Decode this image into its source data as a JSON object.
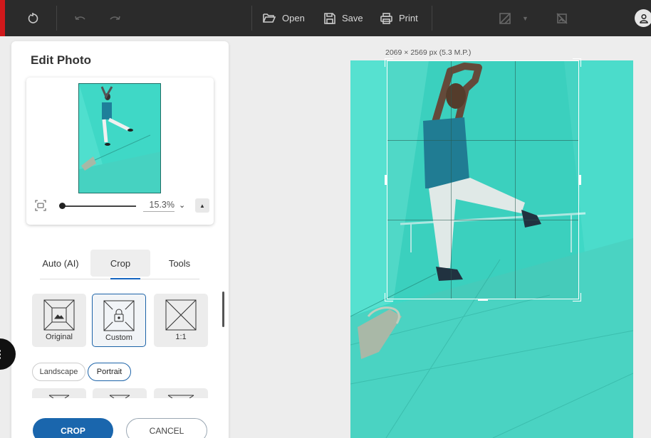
{
  "toolbar": {
    "open_label": "Open",
    "save_label": "Save",
    "print_label": "Print"
  },
  "panel": {
    "title": "Edit Photo",
    "zoom_value": "15.3%",
    "tabs": [
      {
        "label": "Auto (AI)"
      },
      {
        "label": "Crop"
      },
      {
        "label": "Tools"
      }
    ],
    "active_tab": "Crop",
    "presets": [
      {
        "label": "Original",
        "icon": "image-frame-icon"
      },
      {
        "label": "Custom",
        "icon": "lock-frame-icon"
      },
      {
        "label": "1:1",
        "icon": "square-cross-icon"
      }
    ],
    "selected_preset": "Custom",
    "orientation": [
      {
        "label": "Landscape"
      },
      {
        "label": "Portrait"
      }
    ],
    "selected_orientation": "Portrait",
    "crop_button": "CROP",
    "cancel_button": "CANCEL"
  },
  "canvas": {
    "dimensions_label": "2069 × 2569 px (5.3 M.P.)"
  },
  "colors": {
    "toolbar_bg": "#2b2b2b",
    "accent": "#1a66ad",
    "photo_tint": "#3fd6c5"
  }
}
